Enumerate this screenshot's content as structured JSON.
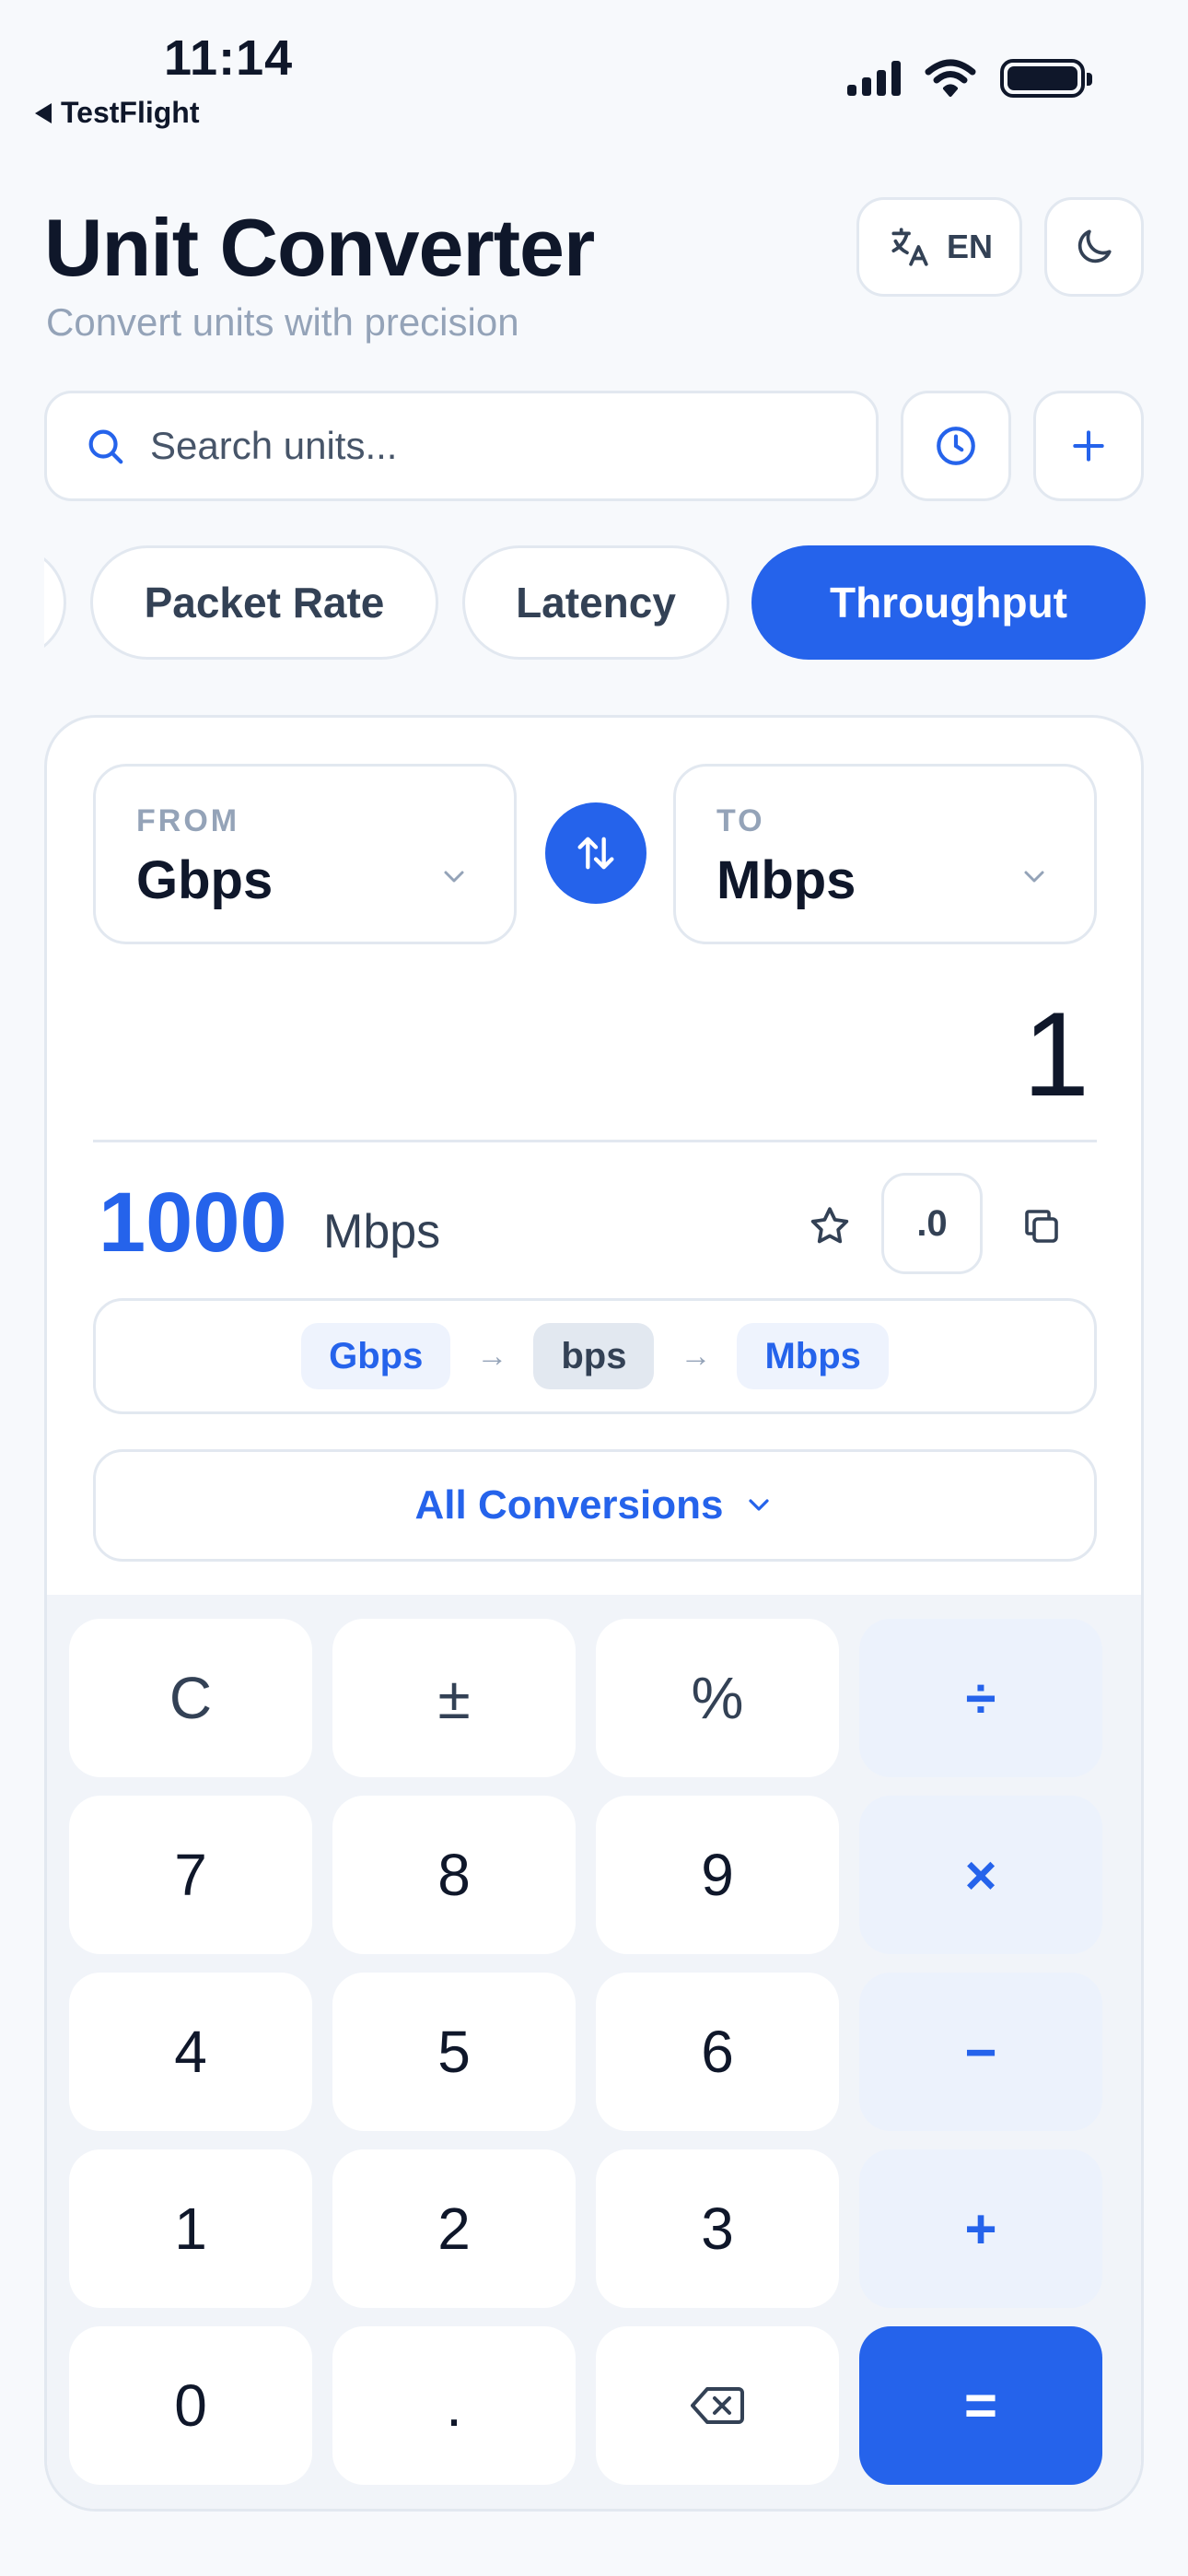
{
  "status_bar": {
    "time": "11:14",
    "back_app": "TestFlight"
  },
  "header": {
    "title": "Unit Converter",
    "subtitle": "Convert units with precision",
    "language_label": "EN"
  },
  "search": {
    "placeholder": "Search units..."
  },
  "categories": [
    {
      "label": "Packet Rate",
      "selected": false
    },
    {
      "label": "Latency",
      "selected": false
    },
    {
      "label": "Throughput",
      "selected": true
    }
  ],
  "converter": {
    "from_caption": "FROM",
    "from_unit": "Gbps",
    "to_caption": "TO",
    "to_unit": "Mbps",
    "input_value": "1",
    "result_value": "1000",
    "result_unit": "Mbps",
    "precision_label": ".0",
    "path": [
      "Gbps",
      "bps",
      "Mbps"
    ],
    "all_conversions_label": "All Conversions"
  },
  "keypad": {
    "rows": [
      [
        "C",
        "±",
        "%",
        "÷"
      ],
      [
        "7",
        "8",
        "9",
        "×"
      ],
      [
        "4",
        "5",
        "6",
        "−"
      ],
      [
        "1",
        "2",
        "3",
        "+"
      ],
      [
        "0",
        ".",
        "backspace",
        "="
      ]
    ]
  },
  "colors": {
    "accent": "#2563eb",
    "background": "#f7f9fc",
    "muted": "#94a3b8"
  }
}
